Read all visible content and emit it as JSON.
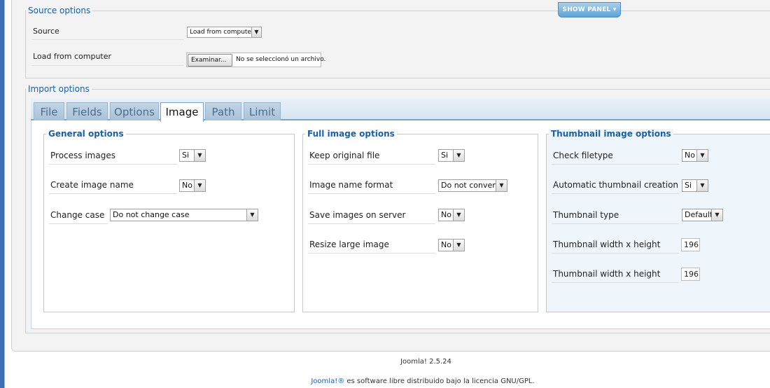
{
  "show_panel": "SHOW PANEL",
  "source_options": {
    "legend": "Source options",
    "source_label": "Source",
    "source_value": "Load from computer",
    "load_label": "Load from computer",
    "browse_button": "Examinar...",
    "no_file_text": "No se seleccionó un archivo."
  },
  "import_options": {
    "legend": "Import options",
    "tabs": [
      {
        "label": "File"
      },
      {
        "label": "Fields"
      },
      {
        "label": "Options"
      },
      {
        "label": "Image"
      },
      {
        "label": "Path"
      },
      {
        "label": "Limit"
      }
    ],
    "active_tab": "Image"
  },
  "general": {
    "title": "General options",
    "process_images_label": "Process images",
    "process_images_value": "Si",
    "create_name_label": "Create image name",
    "create_name_value": "No",
    "change_case_label": "Change case",
    "change_case_value": "Do not change case"
  },
  "full_image": {
    "title": "Full image options",
    "keep_original_label": "Keep original file",
    "keep_original_value": "Si",
    "name_format_label": "Image name format",
    "name_format_value": "Do not convert",
    "save_server_label": "Save images on server",
    "save_server_value": "No",
    "resize_label": "Resize large image",
    "resize_value": "No"
  },
  "thumbnail": {
    "title": "Thumbnail image options",
    "check_filetype_label": "Check filetype",
    "check_filetype_value": "No",
    "auto_thumb_label": "Automatic thumbnail creation",
    "auto_thumb_value": "Si",
    "thumb_type_label": "Thumbnail type",
    "thumb_type_value": "Default",
    "width_height_label_1": "Thumbnail width x height",
    "width_value_1": "196",
    "width_height_label_2": "Thumbnail width x height",
    "width_value_2": "196"
  },
  "footer": {
    "version": "Joomla! 2.5.24",
    "link": "Joomla!®",
    "license": " es software libre distribuido bajo la licencia GNU/GPL."
  },
  "icons": {
    "select_arrow": "chevron-down-icon"
  }
}
